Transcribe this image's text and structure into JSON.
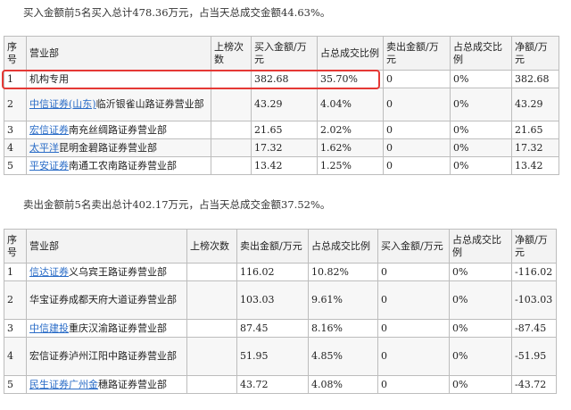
{
  "buy": {
    "summary": "买入金额前5名买入总计478.36万元，占当天总成交金额44.63%。",
    "headers": [
      "序号",
      "营业部",
      "上榜次数",
      "买入金额/万元",
      "占总成交比例",
      "卖出金额/万元",
      "占总成交比例",
      "净额/万元"
    ],
    "rows": [
      {
        "no": "1",
        "dept_link": "",
        "dept_rest": "机构专用",
        "times": "",
        "buy": "382.68",
        "buy_pct": "35.70%",
        "sell": "0",
        "sell_pct": "0%",
        "net": "382.68"
      },
      {
        "no": "2",
        "dept_link": "中信证券(山东)",
        "dept_rest": "临沂银雀山路证券营业部",
        "times": "",
        "buy": "43.29",
        "buy_pct": "4.04%",
        "sell": "0",
        "sell_pct": "0%",
        "net": "43.29"
      },
      {
        "no": "3",
        "dept_link": "宏信证券",
        "dept_rest": "南充丝绸路证券营业部",
        "times": "",
        "buy": "21.65",
        "buy_pct": "2.02%",
        "sell": "0",
        "sell_pct": "0%",
        "net": "21.65"
      },
      {
        "no": "4",
        "dept_link": "太平洋",
        "dept_rest": "昆明金碧路证券营业部",
        "times": "",
        "buy": "17.32",
        "buy_pct": "1.62%",
        "sell": "0",
        "sell_pct": "0%",
        "net": "17.32"
      },
      {
        "no": "5",
        "dept_link": "平安证券",
        "dept_rest": "南通工农南路证券营业部",
        "times": "",
        "buy": "13.42",
        "buy_pct": "1.25%",
        "sell": "0",
        "sell_pct": "0%",
        "net": "13.42"
      }
    ]
  },
  "sell": {
    "summary": "卖出金额前5名卖出总计402.17万元，占当天总成交金额37.52%。",
    "headers": [
      "序号",
      "营业部",
      "上榜次数",
      "卖出金额/万元",
      "占总成交比例",
      "买入金额/万元",
      "占总成交比例",
      "净额/万元"
    ],
    "rows": [
      {
        "no": "1",
        "dept_link": "信达证券",
        "dept_rest": "义乌宾王路证券营业部",
        "times": "",
        "sell": "116.02",
        "sell_pct": "10.82%",
        "buy": "0",
        "buy_pct": "0%",
        "net": "-116.02"
      },
      {
        "no": "2",
        "dept_link": "",
        "dept_rest": "华宝证券成都天府大道证券营业部",
        "times": "",
        "sell": "103.03",
        "sell_pct": "9.61%",
        "buy": "0",
        "buy_pct": "0%",
        "net": "-103.03"
      },
      {
        "no": "3",
        "dept_link": "中信建投",
        "dept_rest": "重庆汉渝路证券营业部",
        "times": "",
        "sell": "87.45",
        "sell_pct": "8.16%",
        "buy": "0",
        "buy_pct": "0%",
        "net": "-87.45"
      },
      {
        "no": "4",
        "dept_link": "",
        "dept_rest": "宏信证券泸州江阳中路证券营业部",
        "times": "",
        "sell": "51.95",
        "sell_pct": "4.85%",
        "buy": "0",
        "buy_pct": "0%",
        "net": "-51.95"
      },
      {
        "no": "5",
        "dept_link": "民生证券广州金",
        "dept_rest": "穗路证券营业部",
        "times": "",
        "sell": "43.72",
        "sell_pct": "4.08%",
        "buy": "0",
        "buy_pct": "0%",
        "net": "-43.72"
      }
    ]
  },
  "highlight_color": "#e53935",
  "link_color": "#2a6cc7"
}
